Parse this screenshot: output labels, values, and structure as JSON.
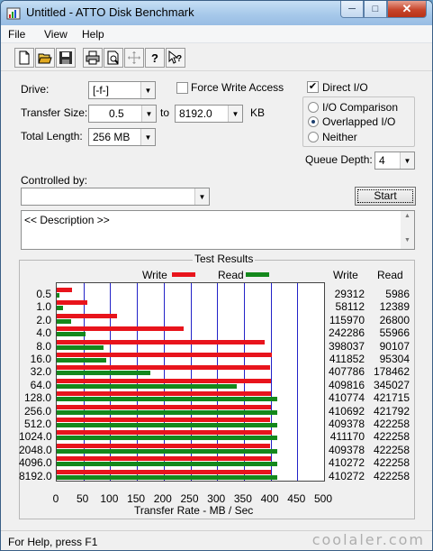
{
  "window": {
    "title": "Untitled - ATTO Disk Benchmark"
  },
  "menu": [
    "File",
    "View",
    "Help"
  ],
  "toolbar": [
    "new-icon",
    "open-icon",
    "save-icon",
    "print-icon",
    "print-preview-icon",
    "move-icon",
    "help-icon",
    "context-help-icon"
  ],
  "settings": {
    "drive_label": "Drive:",
    "drive_value": "[-f-]",
    "force_write_label": "Force Write Access",
    "direct_io_label": "Direct I/O",
    "transfer_size_label": "Transfer Size:",
    "transfer_from": "0.5",
    "to_label": "to",
    "transfer_to": "8192.0",
    "kb_label": "KB",
    "total_length_label": "Total Length:",
    "total_length_value": "256 MB",
    "io_comparison_label": "I/O Comparison",
    "overlapped_io_label": "Overlapped I/O",
    "neither_label": "Neither",
    "queue_depth_label": "Queue Depth:",
    "queue_depth_value": "4",
    "controlled_by_label": "Controlled by:",
    "controlled_by_value": "",
    "start_label": "Start",
    "description_text": "<< Description >>"
  },
  "results": {
    "title": "Test Results",
    "write_label": "Write",
    "read_label": "Read",
    "col_write": "Write",
    "col_read": "Read"
  },
  "chart_data": {
    "type": "bar",
    "xlabel": "Transfer Rate - MB / Sec",
    "xlim": [
      0,
      500
    ],
    "xticks": [
      "0",
      "50",
      "100",
      "150",
      "200",
      "250",
      "300",
      "350",
      "400",
      "450",
      "500"
    ],
    "categories": [
      "0.5",
      "1.0",
      "2.0",
      "4.0",
      "8.0",
      "16.0",
      "32.0",
      "64.0",
      "128.0",
      "256.0",
      "512.0",
      "1024.0",
      "2048.0",
      "4096.0",
      "8192.0"
    ],
    "series": [
      {
        "name": "Write",
        "color": "#e8141c",
        "values": [
          29312,
          58112,
          115970,
          242286,
          398037,
          411852,
          407786,
          409816,
          410774,
          410692,
          409378,
          411170,
          409378,
          410272,
          410272
        ]
      },
      {
        "name": "Read",
        "color": "#14881c",
        "values": [
          5986,
          12389,
          26800,
          55966,
          90107,
          95304,
          178462,
          345027,
          421715,
          421792,
          422258,
          422258,
          422258,
          422258,
          422258
        ]
      }
    ]
  },
  "status": {
    "text": "For Help, press F1"
  },
  "watermark": "coolaler.com"
}
